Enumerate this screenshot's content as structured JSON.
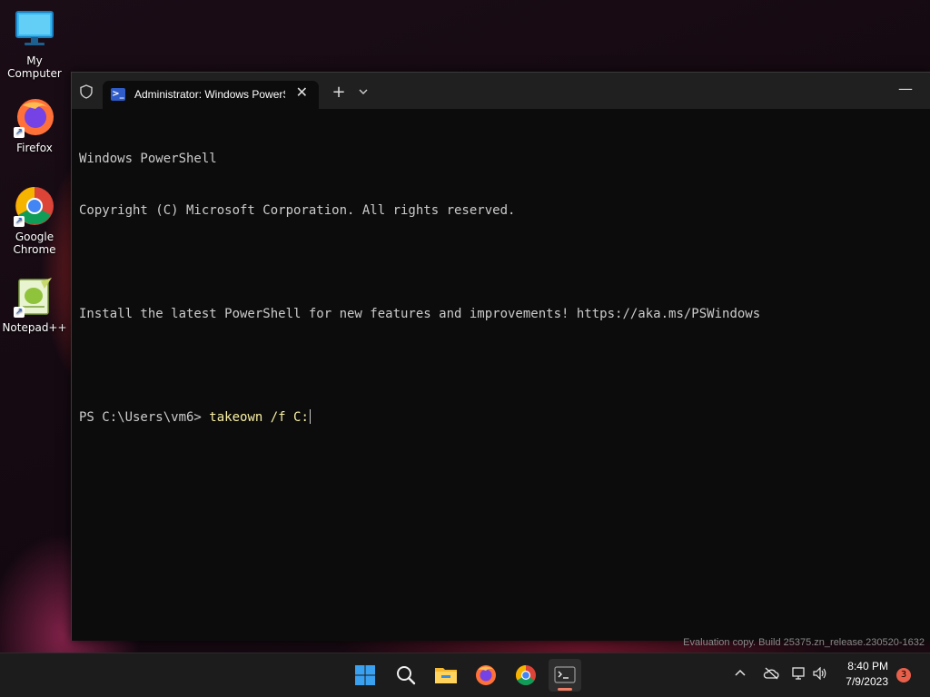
{
  "desktop": {
    "icons": [
      {
        "label": "My Computer"
      },
      {
        "label": "Firefox"
      },
      {
        "label": "Google Chrome"
      },
      {
        "label": "Notepad++"
      }
    ]
  },
  "terminal": {
    "tab_title": "Administrator: Windows PowerShell",
    "tab_close": "✕",
    "new_tab": "+",
    "minimize": "—",
    "lines": [
      "Windows PowerShell",
      "Copyright (C) Microsoft Corporation. All rights reserved.",
      "",
      "Install the latest PowerShell for new features and improvements! https://aka.ms/PSWindows",
      ""
    ],
    "prompt": "PS C:\\Users\\vm6> ",
    "command": "takeown /f C:",
    "icon": "powershell-icon",
    "colors": {
      "background": "#0c0c0c",
      "text": "#cccccc",
      "command": "#f9f1a5"
    }
  },
  "watermark": "Evaluation copy. Build 25375.zn_release.230520-1632",
  "taskbar": {
    "apps": [
      "start",
      "search",
      "file-explorer",
      "firefox",
      "chrome",
      "terminal"
    ],
    "active_app": "terminal",
    "clock_time": "8:40 PM",
    "clock_date": "7/9/2023",
    "notification_count": "3"
  }
}
